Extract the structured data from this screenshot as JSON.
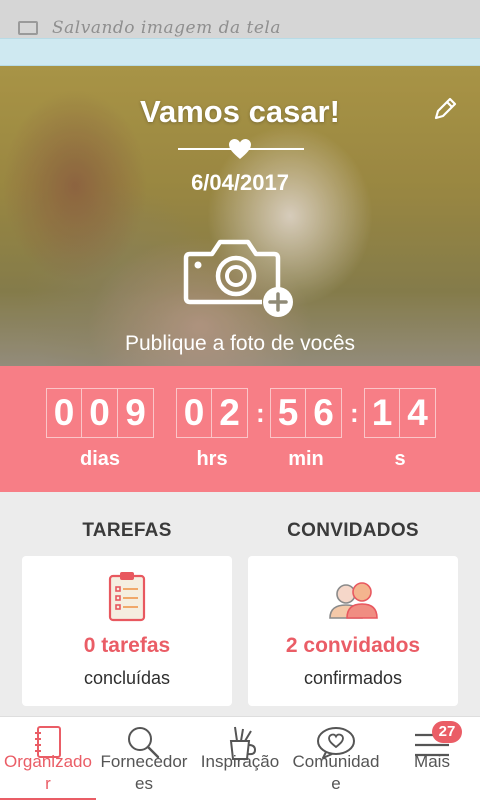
{
  "status_bar": {
    "text": "Salvando imagem da tela"
  },
  "hero": {
    "title": "Vamos casar!",
    "date": "6/04/2017",
    "publish_text": "Publique a foto de vocês"
  },
  "countdown": {
    "days": [
      "0",
      "0",
      "9"
    ],
    "hours": [
      "0",
      "2"
    ],
    "minutes": [
      "5",
      "6"
    ],
    "seconds": [
      "1",
      "4"
    ],
    "days_label": "dias",
    "hours_label": "hrs",
    "minutes_label": "min",
    "seconds_label": "s",
    "separator": ":"
  },
  "summary": {
    "tasks": {
      "title": "TAREFAS",
      "count": "0 tarefas",
      "sub": "concluídas",
      "icon": "clipboard-checklist-icon"
    },
    "guests": {
      "title": "CONVIDADOS",
      "count": "2 convidados",
      "sub": "confirmados",
      "icon": "couple-icon"
    }
  },
  "nav": {
    "items": [
      {
        "label": "Organizado\nr",
        "icon": "notebook-icon"
      },
      {
        "label": "Fornecedor\nes",
        "icon": "search-icon"
      },
      {
        "label": "Inspiração",
        "icon": "brushes-icon"
      },
      {
        "label": "Comunidad\ne",
        "icon": "heart-chat-icon"
      },
      {
        "label": "Mais",
        "icon": "menu-icon"
      }
    ],
    "badge": "27"
  },
  "colors": {
    "accent": "#f77e86",
    "accent_text": "#ea5d66",
    "background": "#ececec"
  }
}
